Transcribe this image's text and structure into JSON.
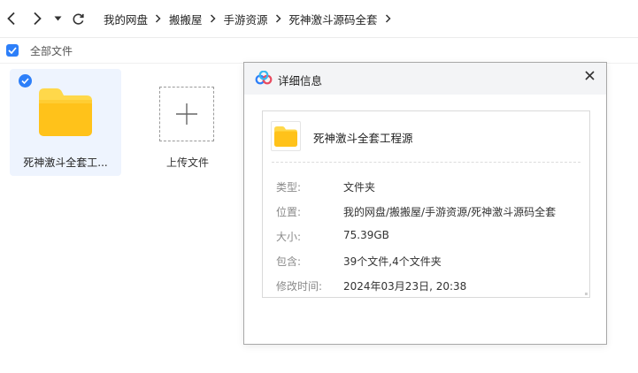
{
  "toolbar": {
    "icons": [
      "back-arrow-icon",
      "forward-arrow-icon",
      "dropdown-caret-icon",
      "refresh-icon"
    ],
    "breadcrumb": [
      "我的网盘",
      "搬搬屋",
      "手游资源",
      "死神激斗源码全套"
    ]
  },
  "select_bar": {
    "checked": true,
    "label": "全部文件"
  },
  "grid": {
    "items": [
      {
        "name": "死神激斗全套工...",
        "type": "folder",
        "selected": true
      }
    ],
    "upload_label": "上传文件"
  },
  "dialog": {
    "title": "详细信息",
    "file_name": "死神激斗全套工程源",
    "rows": [
      {
        "label": "类型:",
        "value": "文件夹"
      },
      {
        "label": "位置:",
        "value": "我的网盘/搬搬屋/手游资源/死神激斗源码全套"
      },
      {
        "label": "大小:",
        "value": "75.39GB"
      },
      {
        "label": "包含:",
        "value": "39个文件,4个文件夹"
      },
      {
        "label": "修改时间:",
        "value": "2024年03月23日, 20:38"
      }
    ]
  },
  "colors": {
    "accent": "#2d7ff9",
    "folder_top": "#ffd84a",
    "folder_body": "#ffc21a",
    "selected_bg": "#eef4fe"
  }
}
